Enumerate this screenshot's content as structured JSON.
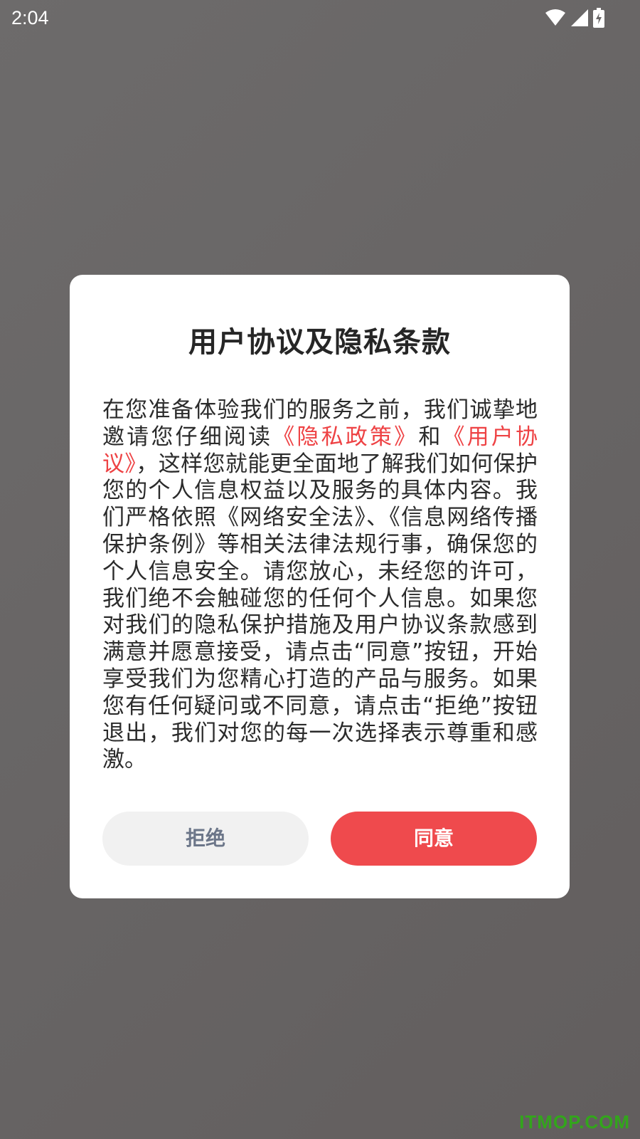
{
  "status_bar": {
    "time": "2:04",
    "icons": [
      "wifi-icon",
      "cell-signal-icon",
      "battery-charging-icon"
    ]
  },
  "dialog": {
    "title": "用户协议及隐私条款",
    "body": {
      "part1": "在您准备体验我们的服务之前，我们诚挚地邀请您仔细阅读",
      "privacy_link": "《隐私政策》",
      "part2": "和",
      "agreement_link": "《用户协议》",
      "part3": "，这样您就能更全面地了解我们如何保护您的个人信息权益以及服务的具体内容。我们严格依照《网络安全法》、《信息网络传播保护条例》等相关法律法规行事，确保您的个人信息安全。请您放心，未经您的许可，我们绝不会触碰您的任何个人信息。如果您对我们的隐私保护措施及用户协议条款感到满意并愿意接受，请点击“同意”按钮，开始享受我们为您精心打造的产品与服务。如果您有任何疑问或不同意，请点击“拒绝”按钮退出，我们对您的每一次选择表示尊重和感激。"
    },
    "reject_label": "拒绝",
    "agree_label": "同意"
  },
  "watermark": "ITMOP.COM",
  "colors": {
    "accent": "#ef4a4d",
    "link": "#ee4244",
    "reject_text": "#6c7689",
    "reject_bg": "#f1f1f1",
    "overlay": "#6a6767"
  }
}
